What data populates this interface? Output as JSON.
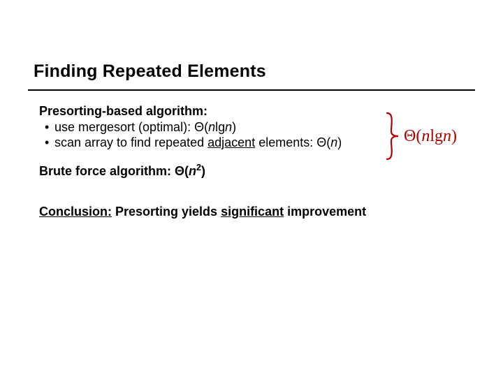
{
  "title": "Finding Repeated Elements",
  "section1": {
    "heading": "Presorting-based algorithm:",
    "b1_pre": "use mergesort (optimal): Θ(",
    "b1_n1": "n",
    "b1_mid": "lg",
    "b1_n2": "n",
    "b1_post": ")",
    "b2_pre": "scan array to find repeated ",
    "b2_adj": "adjacent",
    "b2_mid": " elements: Θ(",
    "b2_n": "n",
    "b2_post": ")"
  },
  "annotation": {
    "theta": "Θ(",
    "n1": "n",
    "lg": "lg",
    "n2": "n",
    "close": ")"
  },
  "section2": {
    "pre": "Brute force algorithm: Θ(",
    "n": "n",
    "exp": "2",
    "post": ")"
  },
  "conclusion": {
    "label": "Conclusion:",
    "mid1": " Presorting yields ",
    "sig": "significant",
    "mid2": " improvement"
  }
}
